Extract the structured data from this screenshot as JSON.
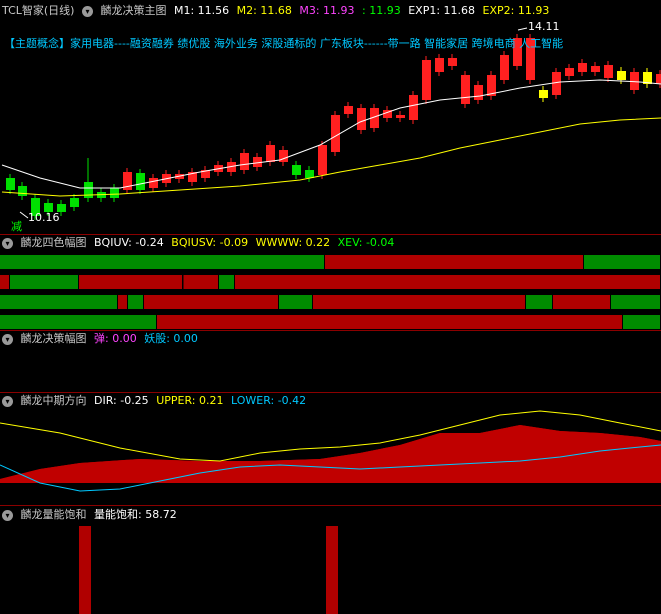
{
  "main": {
    "stock": "TCL智家(日线)",
    "indicator": "麟龙决策主图",
    "m1": "M1: 11.56",
    "m2": "M2: 11.68",
    "m3": "M3: 11.93",
    "ma": ": 11.93",
    "exp1": "EXP1: 11.68",
    "exp2": "EXP2: 11.93",
    "concept": "【主题概念】家用电器----融资融券 绩优股 海外业务 深股通标的 广东板块------带一路 智能家居 跨境电商 人工智能",
    "high_label": "14.11",
    "low_label": "10.16",
    "signal": "减"
  },
  "panel2": {
    "title": "麟龙四色幅图",
    "bqiuv": "BQIUV: -0.24",
    "bqiusv": "BQIUSV: -0.09",
    "wwww": "WWWW: 0.22",
    "xev": "XEV: -0.04"
  },
  "panel3": {
    "title": "麟龙决策幅图",
    "tan": "弹: 0.00",
    "yao": "妖股: 0.00"
  },
  "panel4": {
    "title": "麟龙中期方向",
    "dir": "DIR: -0.25",
    "upper": "UPPER: 0.21",
    "lower": "LOWER: -0.42"
  },
  "panel5": {
    "title": "麟龙量能饱和",
    "label": "量能饱和: 58.72"
  },
  "colors": {
    "up": "#ff2020",
    "down": "#00e000",
    "yellow": "#ffff00",
    "cyan": "#00c8ff",
    "magenta": "#ff44ff",
    "barred": "#b00000",
    "bargreen": "#008c00"
  }
}
